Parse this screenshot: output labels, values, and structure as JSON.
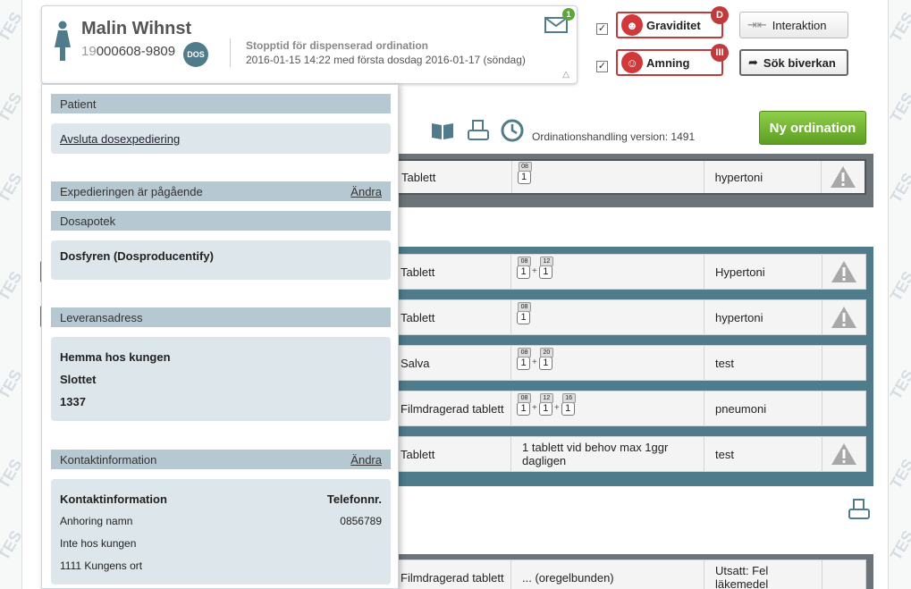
{
  "watermark": "TES",
  "patient": {
    "name": "Malin Wihnst",
    "id_prefix": "19",
    "id_rest": "000608-9809",
    "dos_badge": "DOS",
    "stop_title": "Stopptid för dispenserad ordination",
    "stop_text": "2016-01-15 14:22 med första dosdag 2016-01-17 (söndag)",
    "mail_count": "1"
  },
  "toggles": {
    "graviditet": {
      "label": "Graviditet",
      "badge": "D",
      "checked": "✓"
    },
    "amning": {
      "label": "Amning",
      "badge": "III",
      "checked": "✓"
    },
    "interaktion": "Interaktion",
    "sok_biverkan": "Sök biverkan"
  },
  "toolbar": {
    "version": "Ordinationshandling version: 1491",
    "new_ordination": "Ny ordination"
  },
  "rows_group1": [
    {
      "form": "Tablett",
      "doses": [
        {
          "t": "08",
          "n": "1"
        }
      ],
      "indication": "hypertoni",
      "warn": true
    }
  ],
  "rows_group2": [
    {
      "form": "Tablett",
      "doses": [
        {
          "t": "08",
          "n": "1"
        },
        {
          "t": "12",
          "n": "1"
        }
      ],
      "indication": "Hypertoni",
      "warn": true
    },
    {
      "form": "Tablett",
      "doses": [
        {
          "t": "08",
          "n": "1"
        }
      ],
      "indication": "hypertoni",
      "warn": true
    },
    {
      "form": "Salva",
      "doses": [
        {
          "t": "08",
          "n": "1"
        },
        {
          "t": "20",
          "n": "1"
        }
      ],
      "indication": "test",
      "warn": false
    },
    {
      "form": "Filmdragerad tablett",
      "doses": [
        {
          "t": "08",
          "n": "1"
        },
        {
          "t": "12",
          "n": "1"
        },
        {
          "t": "16",
          "n": "1"
        }
      ],
      "indication": "pneumoni",
      "warn": false
    },
    {
      "form": "Tablett",
      "dose_text": "1 tablett vid behov max 1ggr dagligen",
      "indication": "test",
      "warn": true
    }
  ],
  "rows_group3": [
    {
      "form": "Filmdragerad tablett",
      "dose_text": "... (oregelbunden)",
      "indication": "Utsatt: Fel läkemedel"
    }
  ],
  "panel": {
    "patient_header": "Patient",
    "avsluta": "Avsluta dosexpediering",
    "exped_header": "Expedieringen är pågående",
    "andra": "Ändra",
    "dosapotek_header": "Dosapotek",
    "dosapotek": "Dosfyren (Dosproducentify)",
    "leverans_header": "Leveransadress",
    "addr1": "Hemma hos kungen",
    "addr2": "Slottet",
    "addr3": "1337",
    "kontakt_header": "Kontaktinformation",
    "kontakt_label": "Kontaktinformation",
    "telefon_label": "Telefonnr.",
    "anhorig": "Anhoring namn",
    "phone": "0856789",
    "line2": "Inte hos kungen",
    "line3": "1111 Kungens ort"
  },
  "bubble": "!"
}
